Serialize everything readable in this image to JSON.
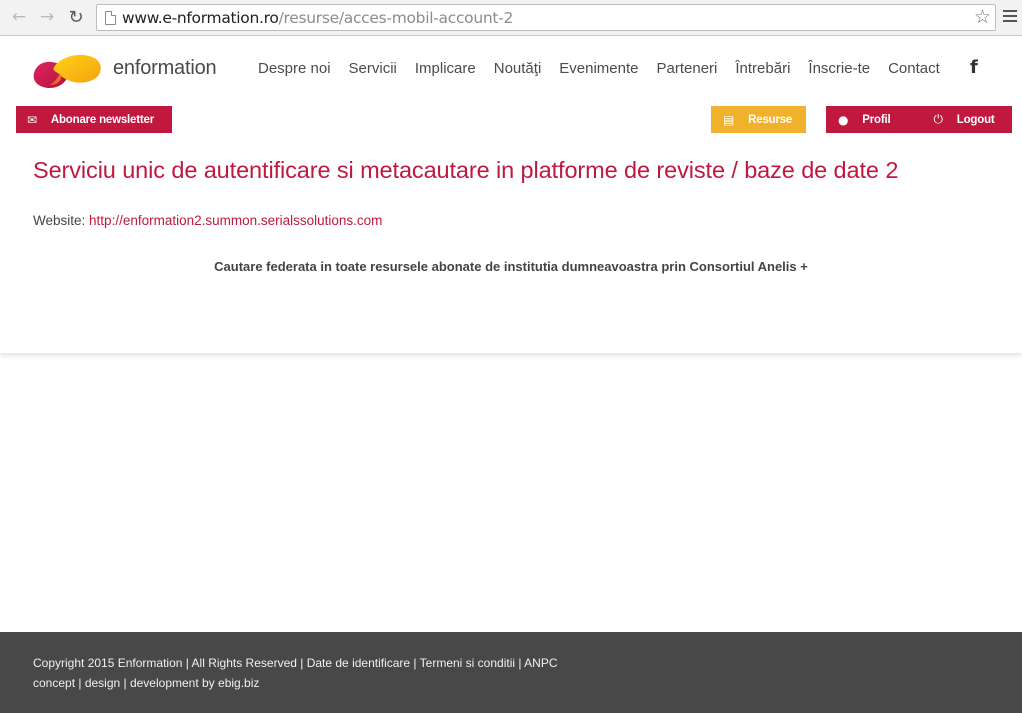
{
  "browser": {
    "url_host": "www.e-nformation.ro",
    "url_path": "/resurse/acces-mobil-account-2"
  },
  "header": {
    "brand": "enformation",
    "nav": [
      "Despre noi",
      "Servicii",
      "Implicare",
      "Noutăţi",
      "Evenimente",
      "Parteneri",
      "Întrebări",
      "Înscrie-te",
      "Contact"
    ],
    "social_icon": "facebook-icon"
  },
  "actions": {
    "newsletter": "Abonare newsletter",
    "resurse": "Resurse",
    "profil": "Profil",
    "logout": "Logout"
  },
  "content": {
    "title": "Serviciu unic de autentificare si metacautare in platforme de reviste / baze de date 2",
    "website_label": "Website:",
    "website_url": "http://enformation2.summon.serialssolutions.com",
    "description": "Cautare federata in toate resursele abonate de institutia dumneavoastra prin Consortiul Anelis +"
  },
  "footer": {
    "line1": "Copyright 2015 Enformation | All Rights Reserved | Date de identificare | Termeni si conditii | ANPC",
    "line2": "concept | design | development by ebig.biz"
  },
  "colors": {
    "brand": "#c0183f",
    "accent": "#f1b12d",
    "footer_bg": "#484848"
  }
}
